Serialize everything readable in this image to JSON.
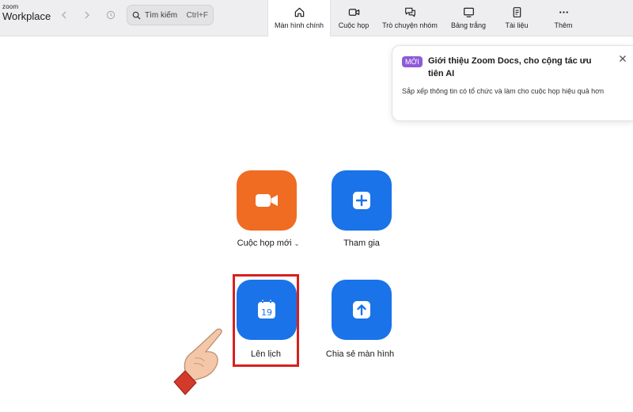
{
  "app": {
    "brand_small": "zoom",
    "brand_big": "Workplace"
  },
  "search": {
    "placeholder": "Tìm kiếm",
    "shortcut": "Ctrl+F"
  },
  "tabs": [
    {
      "label": "Màn hình chính",
      "icon": "home-icon",
      "active": true
    },
    {
      "label": "Cuộc họp",
      "icon": "video-camera-icon",
      "active": false
    },
    {
      "label": "Trò chuyện nhóm",
      "icon": "chat-icon",
      "active": false
    },
    {
      "label": "Bảng trắng",
      "icon": "whiteboard-icon",
      "active": false
    },
    {
      "label": "Tài liệu",
      "icon": "document-icon",
      "active": false
    },
    {
      "label": "Thêm",
      "icon": "more-icon",
      "active": false
    }
  ],
  "notification": {
    "badge": "MỚI",
    "title": "Giới thiệu Zoom Docs, cho cộng tác ưu tiên AI",
    "description": "Sắp xếp thông tin có tổ chức và làm cho cuộc họp hiệu quả hơn"
  },
  "actions": {
    "new_meeting": {
      "label": "Cuộc họp mới",
      "icon": "video-camera-icon"
    },
    "join": {
      "label": "Tham gia",
      "icon": "plus-icon"
    },
    "schedule": {
      "label": "Lên lịch",
      "icon": "calendar-icon",
      "calendar_day": "19"
    },
    "share_screen": {
      "label": "Chia sẻ màn hình",
      "icon": "upload-arrow-icon"
    }
  },
  "colors": {
    "orange": "#ef6c22",
    "blue": "#1a73e8",
    "highlight": "#d6211f",
    "badge": "#8e5bd8"
  }
}
